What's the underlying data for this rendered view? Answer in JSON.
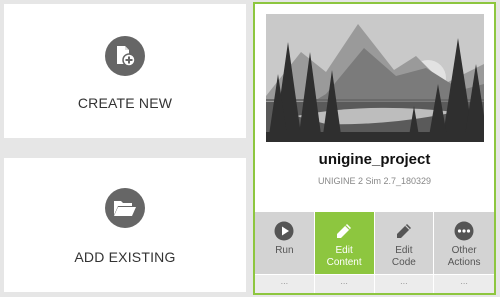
{
  "tiles": {
    "create_new": {
      "label": "CREATE NEW",
      "icon": "add-file-icon"
    },
    "add_existing": {
      "label": "ADD EXISTING",
      "icon": "folder-open-icon"
    }
  },
  "project": {
    "name": "unigine_project",
    "sdk": "UNIGINE 2 Sim 2.7_180329",
    "thumbnail_icon": "mountain-landscape-thumbnail",
    "actions": [
      {
        "label": "Run",
        "icon": "play-icon"
      },
      {
        "label": "Edit\nContent",
        "icon": "pencil-icon"
      },
      {
        "label": "Edit\nCode",
        "icon": "pencil-icon"
      },
      {
        "label": "Other\nActions",
        "icon": "ellipsis-icon"
      }
    ],
    "more": [
      "...",
      "...",
      "...",
      "..."
    ]
  },
  "colors": {
    "accent": "#8dc63f",
    "icon_circle": "#666666",
    "background": "#e6e6e6"
  }
}
